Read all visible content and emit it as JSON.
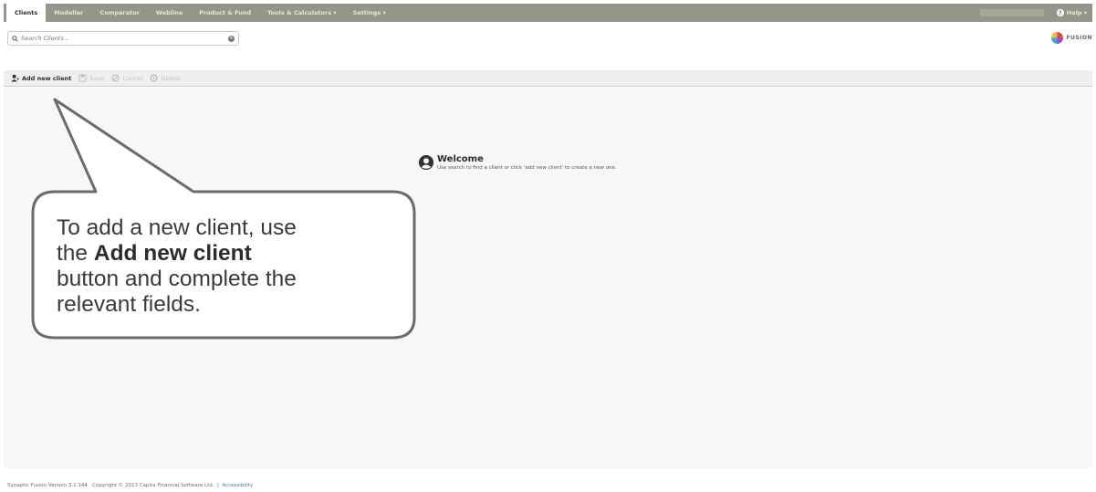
{
  "nav": {
    "tabs": [
      "Clients",
      "Modeller",
      "Comparator",
      "Webline",
      "Product & Fund",
      "Tools & Calculators ▾",
      "Settings ▾"
    ],
    "active_tab": "Clients",
    "help_label": "Help ▾"
  },
  "search": {
    "placeholder": "Search Clients..."
  },
  "logo": {
    "text": "FUSION"
  },
  "toolbar": {
    "add_label": "Add new client",
    "save_label": "Save",
    "cancel_label": "Cancel",
    "delete_label": "Delete"
  },
  "welcome": {
    "title": "Welcome",
    "text": "Use search to find a client or click 'add new client' to create a new one."
  },
  "callout": {
    "line1": "To add a new client, use",
    "line2_prefix": "the ",
    "line2_bold": "Add new client",
    "line3": "button and complete the",
    "line4": "relevant fields."
  },
  "footer": {
    "version": "Synaptic Fusion Version 3.1.144",
    "copyright": "Copyright © 2013 Capita Financial Software Ltd.",
    "separator": "|",
    "link": "Accessibility"
  },
  "colors": {
    "nav_bg": "#95968a",
    "toolbar_bg": "#efefee",
    "main_bg": "#f7f7f8",
    "link": "#3b78c4",
    "callout_border": "#6b6b6b"
  }
}
